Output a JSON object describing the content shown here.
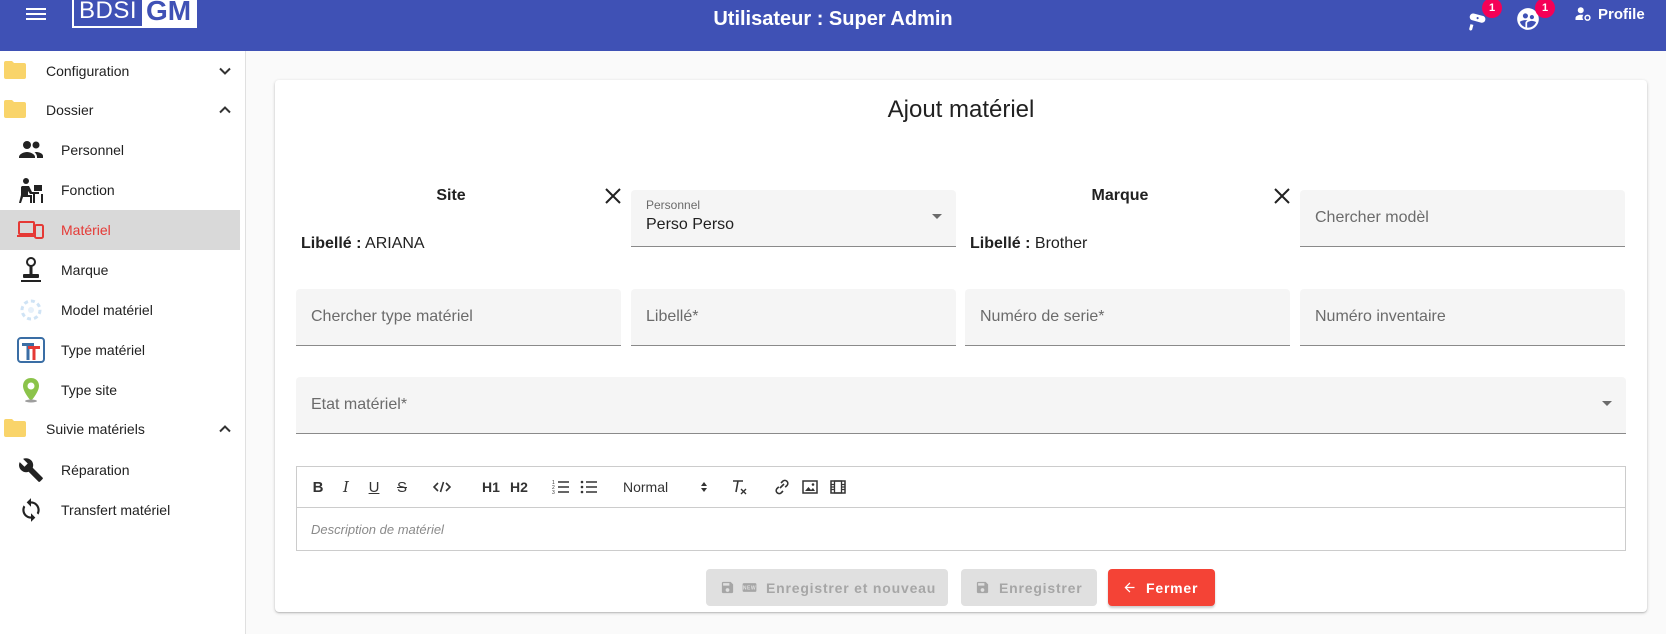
{
  "header": {
    "logo_part1": "BDSI",
    "logo_part2": "GM",
    "title": "Utilisateur : Super Admin",
    "notif1_count": "1",
    "notif2_count": "1",
    "profile_label": "Profile"
  },
  "sidebar": {
    "groups": [
      {
        "label": "Configuration",
        "expanded": false
      },
      {
        "label": "Dossier",
        "expanded": true
      },
      {
        "label": "Suivie matériels",
        "expanded": true
      }
    ],
    "items": [
      {
        "label": "Personnel",
        "icon": "people-icon"
      },
      {
        "label": "Fonction",
        "icon": "worker-desk-icon"
      },
      {
        "label": "Matériel",
        "icon": "devices-icon",
        "active": true
      },
      {
        "label": "Marque",
        "icon": "stamp-icon"
      },
      {
        "label": "Model matériel",
        "icon": "model-icon"
      },
      {
        "label": "Type matériel",
        "icon": "type-t-icon"
      },
      {
        "label": "Type site",
        "icon": "location-pin-icon"
      },
      {
        "label": "Réparation",
        "icon": "wrench-icon"
      },
      {
        "label": "Transfert matériel",
        "icon": "sync-icon"
      }
    ]
  },
  "form": {
    "title": "Ajout matériel",
    "site": {
      "heading": "Site",
      "label": "Libellé :",
      "value": "ARIANA"
    },
    "personnel": {
      "label": "Personnel",
      "value": "Perso Perso"
    },
    "marque": {
      "heading": "Marque",
      "label": "Libellé :",
      "value": "Brother"
    },
    "modele_placeholder": "Chercher modèl",
    "type_placeholder": "Chercher type matériel",
    "libelle_placeholder": "Libellé*",
    "serie_placeholder": "Numéro de serie*",
    "inventaire_placeholder": "Numéro inventaire",
    "etat_placeholder": "Etat matériel*",
    "editor": {
      "header_select": "Normal",
      "h1": "H1",
      "h2": "H2",
      "placeholder": "Description de matériel"
    }
  },
  "buttons": {
    "save_new": "Enregistrer et nouveau",
    "save": "Enregistrer",
    "close": "Fermer"
  },
  "colors": {
    "appbar": "#3f51b5",
    "badge": "#f50057",
    "active_text": "#e53935",
    "close_button": "#f44336"
  }
}
